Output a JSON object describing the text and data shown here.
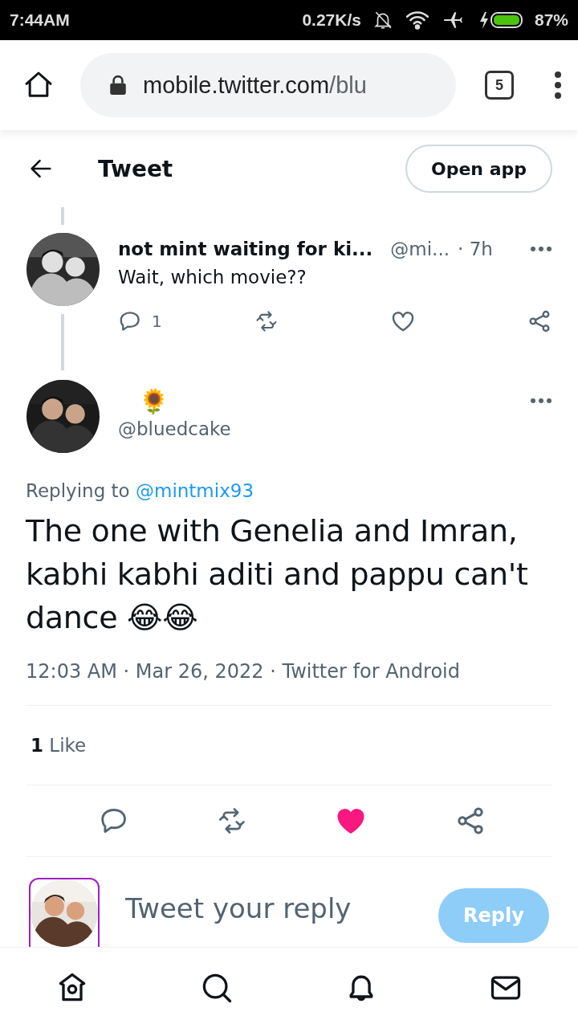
{
  "status_bar": {
    "time": "7:44AM",
    "net_speed": "0.27K/s",
    "battery": "87%"
  },
  "browser": {
    "url_host": "mobile.twitter.com",
    "url_path": "/blu",
    "tab_count": "5"
  },
  "header": {
    "title": "Tweet",
    "open_app": "Open app"
  },
  "parent_tweet": {
    "name": "not mint waiting for ki...",
    "handle": "@mi...",
    "time": "· 7h",
    "text": "Wait, which movie??",
    "reply_count": "1",
    "liked": false
  },
  "main_tweet": {
    "name": "🌻",
    "handle": "@bluedcake",
    "replying_text": "Replying to",
    "replying_to": "@mintmix93",
    "text": "The one with Genelia and Imran, kabhi kabhi aditi and pappu can't dance 😂😂",
    "meta": "12:03 AM · Mar 26, 2022 · Twitter for Android",
    "likes": "**1** Like",
    "liked": true
  },
  "composer": {
    "placeholder": "Tweet your reply",
    "button": "Reply",
    "disabled": true
  }
}
